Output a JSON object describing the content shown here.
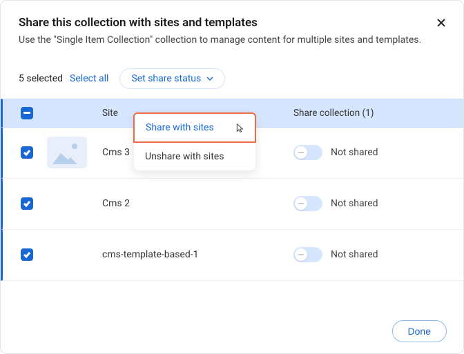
{
  "header": {
    "title": "Share this collection with sites and templates",
    "subtitle": "Use the \"Single Item Collection\" collection to manage content for multiple sites and templates."
  },
  "toolbar": {
    "selected_count": "5 selected",
    "select_all": "Select all",
    "set_status": "Set share status"
  },
  "dropdown": {
    "share": "Share with sites",
    "unshare": "Unshare with sites"
  },
  "columns": {
    "site": "Site",
    "share": "Share collection (1)"
  },
  "rows": [
    {
      "name": "Cms 3",
      "status": "Not shared",
      "thumb": "image"
    },
    {
      "name": "Cms 2",
      "status": "Not shared",
      "thumb": "blank"
    },
    {
      "name": "cms-template-based-1",
      "status": "Not shared",
      "thumb": "blank"
    }
  ],
  "footer": {
    "done": "Done"
  }
}
